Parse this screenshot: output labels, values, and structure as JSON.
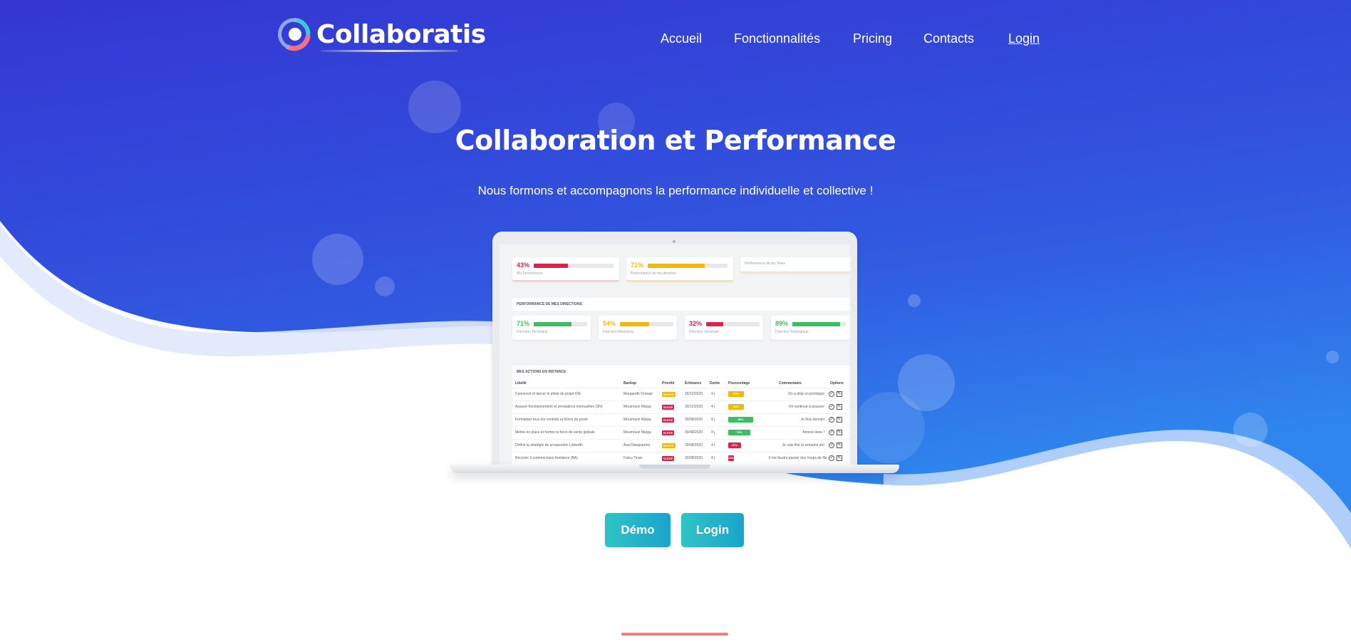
{
  "brand": {
    "name": "Collaboratis"
  },
  "nav": {
    "items": [
      {
        "label": "Accueil"
      },
      {
        "label": "Fonctionnalités"
      },
      {
        "label": "Pricing"
      },
      {
        "label": "Contacts"
      },
      {
        "label": "Login"
      }
    ]
  },
  "hero": {
    "title": "Collaboration et Performance",
    "subtitle": "Nous formons et accompagnons la performance individuelle et collective !"
  },
  "dashboard": {
    "top_kpis": [
      {
        "pct": "43%",
        "value": 0.43,
        "label": "Ma Performance",
        "color": "#d9254c"
      },
      {
        "pct": "71%",
        "value": 0.71,
        "label": "Performance de ma direction",
        "color": "#f2b70f"
      }
    ],
    "team_card_label": "Performance de my Team",
    "directions_title": "PERFORMANCE DE MES DIRECTIONS",
    "directions": [
      {
        "pct": "71%",
        "value": 0.71,
        "label": "Direction Technique",
        "color": "#3cbf62"
      },
      {
        "pct": "54%",
        "value": 0.54,
        "label": "Direction Marketing",
        "color": "#f2b70f"
      },
      {
        "pct": "32%",
        "value": 0.32,
        "label": "Direction Générale",
        "color": "#d9254c"
      },
      {
        "pct": "89%",
        "value": 0.89,
        "label": "Direction Stratégique",
        "color": "#3cbf62"
      }
    ],
    "actions_title": "MES ACTIONS EN INSTANCE",
    "columns": [
      "Libellé",
      "Backup",
      "Priorité",
      "Échéance",
      "Durée",
      "Pourcentage",
      "Commentaire",
      "Options"
    ],
    "rows": [
      {
        "libelle": "Concevoir et lancer le pilote du projet IDE",
        "backup": "Margareth Orange",
        "priority": "MOYEN",
        "priority_color": "#f2b70f",
        "due": "15/12/2020",
        "duration": "4 j",
        "pct": "50%",
        "pct_value": 0.5,
        "pct_color": "#f2b70f",
        "comment": "On a déjà un prototype"
      },
      {
        "libelle": "Assurer fonctionnement et prestations mensuelles (SN)",
        "backup": "Moumouni Maïga",
        "priority": "ELEVÉ",
        "priority_color": "#d9254c",
        "due": "30/12/2020",
        "duration": "4 j",
        "pct": "50%",
        "pct_value": 0.5,
        "pct_color": "#f2b70f",
        "comment": "On continue à pousser"
      },
      {
        "libelle": "Formaliser tous les contrats et fiches de poste",
        "backup": "Moumouni Maïga",
        "priority": "ELEVÉ",
        "priority_color": "#d9254c",
        "due": "30/08/2020",
        "duration": "4 j",
        "pct": "80%",
        "pct_value": 0.8,
        "pct_color": "#3cbf62",
        "comment": "Je finis demain"
      },
      {
        "libelle": "Mettre en place et former la force de vente globale",
        "backup": "Moumouni Maïga",
        "priority": "ELEVÉ",
        "priority_color": "#d9254c",
        "due": "30/08/2020",
        "duration": "4 j",
        "pct": "70%",
        "pct_value": 0.7,
        "pct_color": "#3cbf62",
        "comment": "Almost done !"
      },
      {
        "libelle": "Définir la stratégie de prospection LinkedIn",
        "backup": "Asel Nanguerma",
        "priority": "MOYEN",
        "priority_color": "#f2b70f",
        "due": "30/08/2020",
        "duration": "4 j",
        "pct": "40%",
        "pct_value": 0.4,
        "pct_color": "#d9254c",
        "comment": "Je vais finir la semaine pro"
      },
      {
        "libelle": "Recruter 3 commerciaux freelance (BA)",
        "backup": "Fatou Tinan",
        "priority": "ELEVÉ",
        "priority_color": "#d9254c",
        "due": "30/08/2020",
        "duration": "4 j",
        "pct": "10%",
        "pct_value": 0.1,
        "pct_color": "#d9254c",
        "comment": "Il me faudra passer des coups de fils"
      }
    ]
  },
  "cta": {
    "demo_label": "Démo",
    "login_label": "Login"
  },
  "colors": {
    "hero_top": "#3436d2",
    "hero_bottom": "#2f80ec",
    "button_gradient_start": "#2ec4c6",
    "button_gradient_end": "#1ba3cc",
    "accent": "#f47c7c"
  }
}
